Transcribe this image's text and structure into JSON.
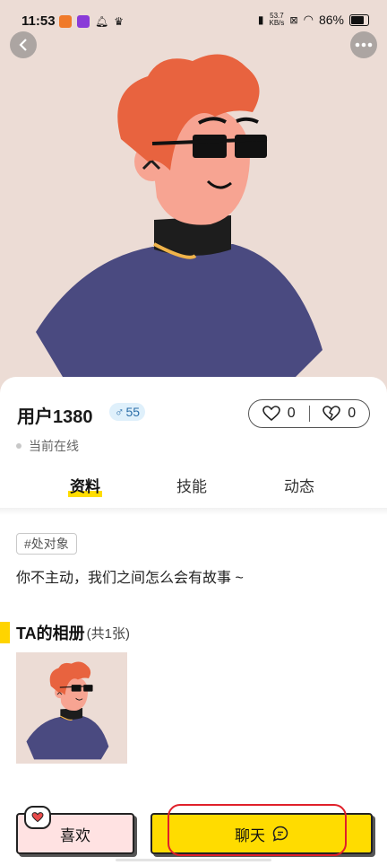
{
  "status_bar": {
    "time": "11:53",
    "net_speed_value": "53.7",
    "net_speed_unit": "KB/s",
    "battery": "86%"
  },
  "profile": {
    "username": "用户1380",
    "gender_symbol": "♂",
    "age": "55",
    "likes": "0",
    "dislikes": "0",
    "online_status": "当前在线"
  },
  "tabs": [
    {
      "label": "资料",
      "active": true
    },
    {
      "label": "技能",
      "active": false
    },
    {
      "label": "动态",
      "active": false
    }
  ],
  "info": {
    "tag": "#处对象",
    "bio": "你不主动，我们之间怎么会有故事 ~"
  },
  "album": {
    "title": "TA的相册",
    "count": "(共1张)"
  },
  "actions": {
    "like_label": "喜欢",
    "chat_label": "聊天"
  },
  "colors": {
    "hero_bg": "#ecdcd5",
    "accent_yellow": "#ffdc00",
    "like_pink": "#ffe2e2",
    "highlight_red": "#e0202a"
  }
}
